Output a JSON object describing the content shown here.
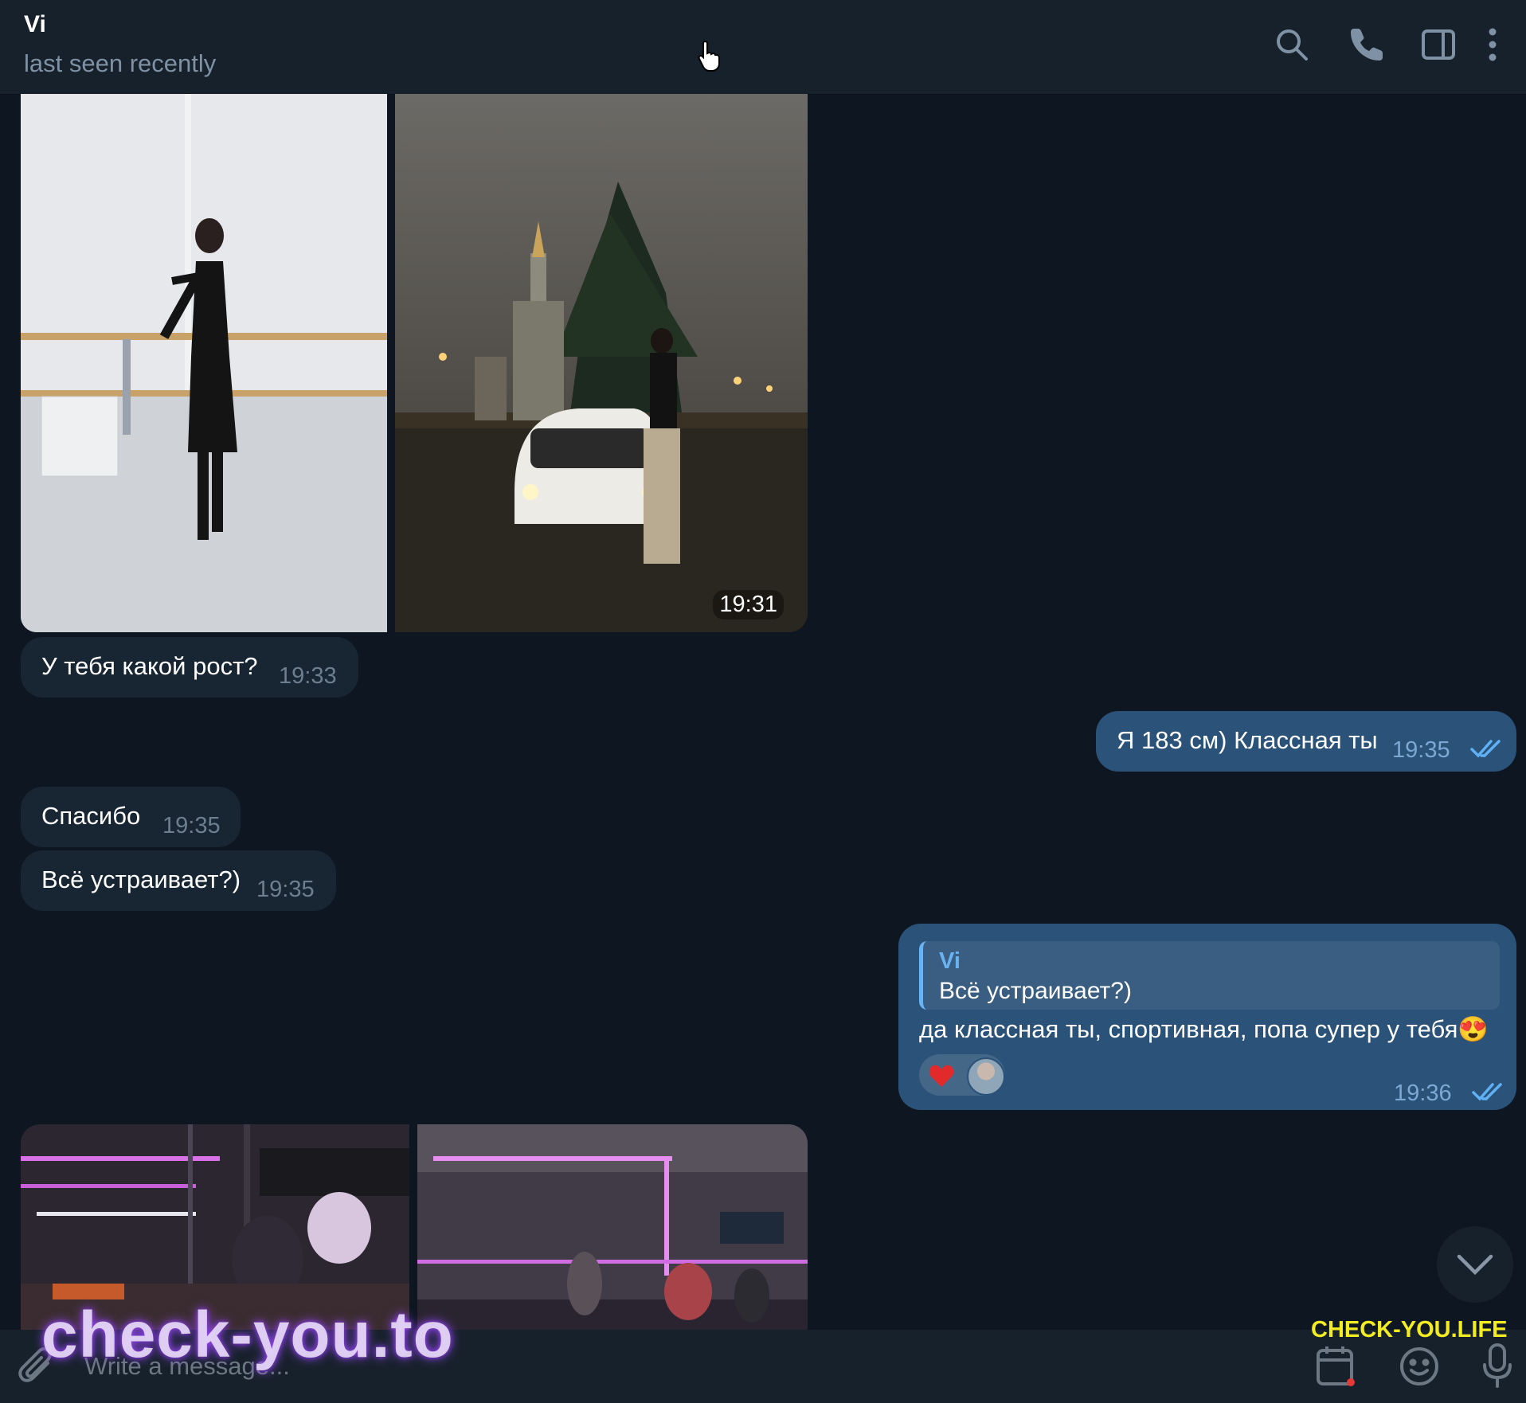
{
  "header": {
    "name": "Vi",
    "status": "last seen recently"
  },
  "messages": {
    "photo_album_1_time": "19:31",
    "m1": {
      "text": "У тебя какой рост?",
      "time": "19:33"
    },
    "m2": {
      "text": "Я 183 см) Классная ты",
      "time": "19:35"
    },
    "m3": {
      "text": "Спасибо",
      "time": "19:35"
    },
    "m4": {
      "text": "Всё устраивает?)",
      "time": "19:35"
    },
    "m5": {
      "reply_name": "Vi",
      "reply_text": "Всё устраивает?)",
      "text": "да классная ты, спортивная, попа супер у тебя😍",
      "time": "19:36",
      "reaction": "❤️"
    }
  },
  "composer": {
    "placeholder": "Write a message..."
  },
  "watermarks": {
    "left": "check-you.to",
    "right": "CHECK-YOU.LIFE"
  },
  "colors": {
    "background": "#0e1621",
    "header": "#17212b",
    "incoming_bubble": "#182533",
    "outgoing_bubble": "#2b5278",
    "accent": "#6ab3f3"
  },
  "icons": [
    "search-icon",
    "phone-icon",
    "sidebar-toggle-icon",
    "more-vertical-icon",
    "chevron-down-icon",
    "paperclip-icon",
    "calendar-icon",
    "emoji-icon",
    "microphone-icon",
    "double-check-icon"
  ]
}
